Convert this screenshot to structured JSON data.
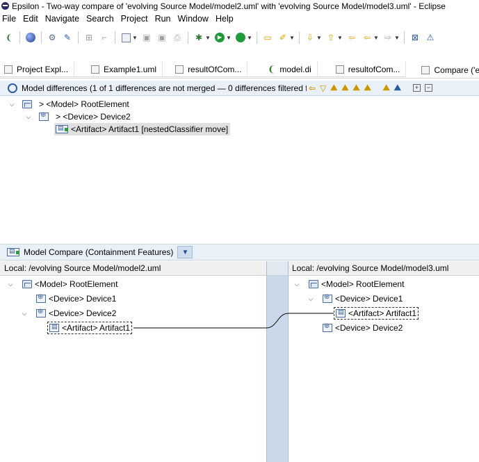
{
  "window": {
    "title": "Epsilon - Two-way compare of 'evolving Source Model/model2.uml' with 'evolving Source Model/model3.uml' - Eclipse"
  },
  "menu": [
    "File",
    "Edit",
    "Navigate",
    "Search",
    "Project",
    "Run",
    "Window",
    "Help"
  ],
  "editor_tabs": [
    {
      "label": "Project Expl...",
      "icon": "project-explorer-icon"
    },
    {
      "label": "Example1.uml",
      "icon": "uml-file-icon"
    },
    {
      "label": "resultOfCom...",
      "icon": "uml-file-icon"
    },
    {
      "label": "model.di",
      "icon": "papyrus-leaf-icon"
    },
    {
      "label": "resultofCom...",
      "icon": "uml-file-icon"
    },
    {
      "label": "Compare ('e",
      "icon": "compare-icon"
    }
  ],
  "model_differences": {
    "header": "Model differences  (1 of 1 differences are not merged — 0 differences filtered f",
    "tree": [
      {
        "label": "> <Model> RootElement",
        "icon": "model-icon",
        "expanded": true
      },
      {
        "label": "> <Device> Device2",
        "icon": "device-icon",
        "expanded": true
      },
      {
        "label": "<Artifact> Artifact1 [nestedClassifier move]",
        "icon": "artifact-icon",
        "selected": true
      }
    ]
  },
  "model_compare": {
    "title": "Model Compare (Containment Features)",
    "left": {
      "header": "Local: /evolving Source Model/model2.uml",
      "tree": [
        {
          "label": "<Model> RootElement",
          "icon": "model-icon"
        },
        {
          "label": "<Device> Device1",
          "icon": "device-icon"
        },
        {
          "label": "<Device> Device2",
          "icon": "device-icon"
        },
        {
          "label": "<Artifact> Artifact1",
          "icon": "artifact-icon"
        }
      ]
    },
    "right": {
      "header": "Local: /evolving Source Model/model3.uml",
      "tree": [
        {
          "label": "<Model> RootElement",
          "icon": "model-icon"
        },
        {
          "label": "<Device> Device1",
          "icon": "device-icon"
        },
        {
          "label": "<Artifact> Artifact1",
          "icon": "artifact-icon"
        },
        {
          "label": "<Device> Device2",
          "icon": "device-icon"
        }
      ]
    }
  },
  "colors": {
    "bar_background": "#eaf0f8",
    "gutter": "#cad9ea",
    "selection": "#e0e0e0"
  }
}
